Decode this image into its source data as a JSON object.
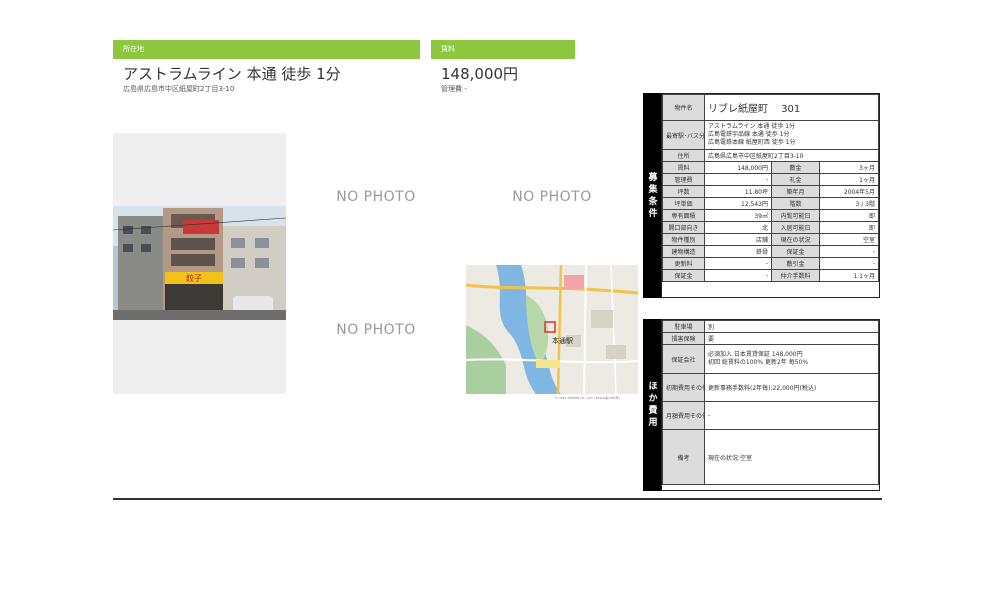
{
  "location": {
    "header": "所在地",
    "title": "アストラムライン 本通 徒歩 1分",
    "address": "広島県広島市中区紙屋町2丁目3-10"
  },
  "rent": {
    "header": "賃料",
    "price": "148,000円",
    "mgmt": "管理費 -"
  },
  "photos": {
    "no_photo_1": "NO PHOTO",
    "no_photo_2": "NO PHOTO",
    "no_photo_3": "NO PHOTO",
    "shop_sign": "餃子"
  },
  "map": {
    "station": "本通駅",
    "copyright": "© 2016 ZENRIN CO., LTD. (Z16LE第1961号)"
  },
  "recruit": {
    "side_label": "募集条件",
    "name_label": "物件名",
    "name_value": "リブレ紙屋町　 301",
    "station_label": "最寄駅･バス分",
    "station_lines": [
      "アストラムライン 本通 徒歩 1分",
      "広島電鉄宇品線 本通 徒歩 1分",
      "広島電鉄本線 紙屋町西 徒歩 1分"
    ],
    "address_label": "住所",
    "address_value": "広島県広島市中区紙屋町2丁目3-10",
    "rows": [
      [
        "賃料",
        "148,000円",
        "敷金",
        "3ヶ月"
      ],
      [
        "管理費",
        "-",
        "礼金",
        "1ヶ月"
      ],
      [
        "坪数",
        "11.80坪",
        "築年月",
        "2004年5月"
      ],
      [
        "坪単価",
        "12,543円",
        "階数",
        "3 / 3階"
      ],
      [
        "専有面積",
        "39㎡",
        "内覧可能日",
        "即"
      ],
      [
        "開口部向き",
        "北",
        "入居可能日",
        "即"
      ],
      [
        "物件種別",
        "店舗",
        "現在の状況",
        "空室"
      ],
      [
        "建物構造",
        "鉄骨",
        "保証金",
        "-"
      ],
      [
        "更新料",
        "-",
        "敷引金",
        "-"
      ],
      [
        "保証金",
        "-",
        "仲介手数料",
        "1.1ヶ月"
      ]
    ]
  },
  "costs": {
    "side_label": "ほか費用",
    "rows": [
      [
        "駐車場",
        "別"
      ],
      [
        "損害保険",
        "要"
      ],
      [
        "保証会社",
        "必須加入 日本賃貸保証 148,000円\n初回 総賃料の100% 更新2年 毎50%"
      ],
      [
        "初期費用その他",
        "更新事務手数料(2年毎):22,000円(税込)"
      ],
      [
        "月額費用その他",
        "-"
      ],
      [
        "備考",
        "現在の状況:空室"
      ]
    ]
  }
}
